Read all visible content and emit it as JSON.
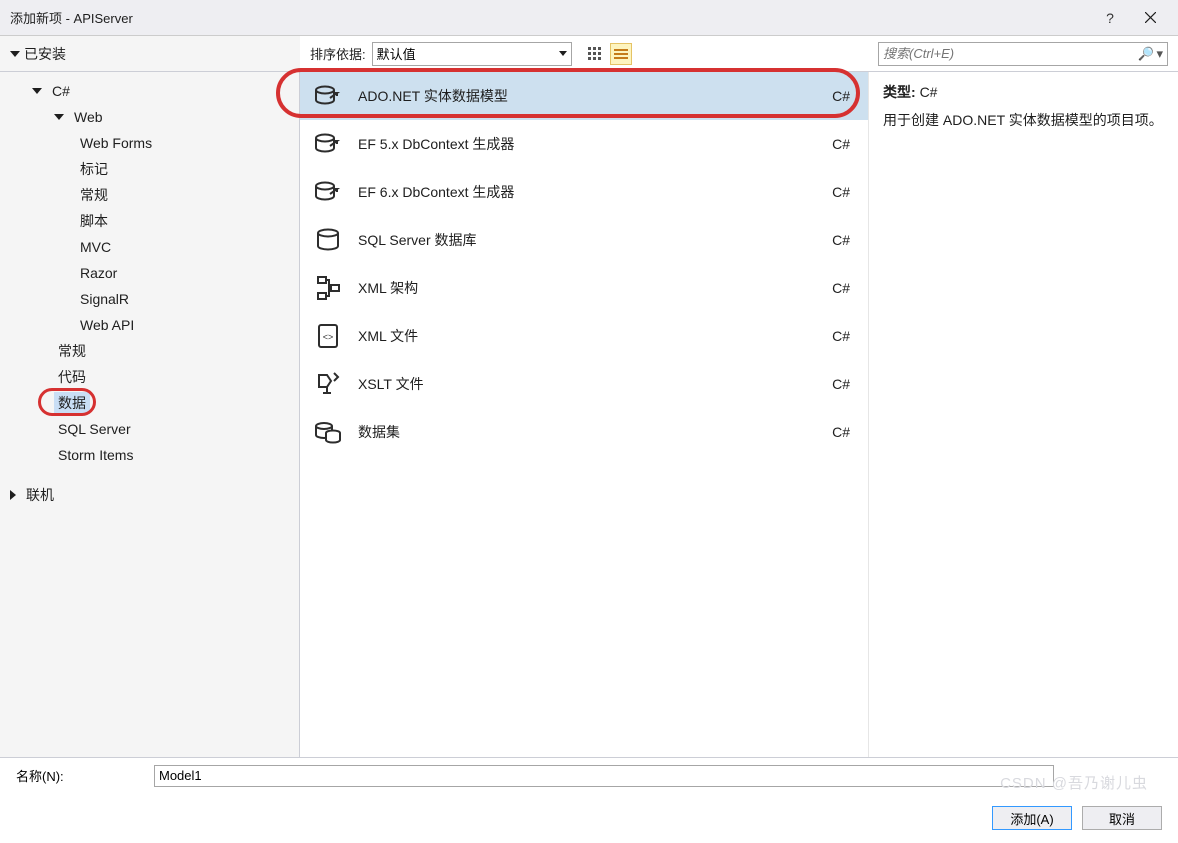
{
  "title": "添加新项 - APIServer",
  "sidebar": {
    "installed_label": "已安装",
    "online_label": "联机",
    "tree": [
      {
        "label": "C#",
        "indent": 1,
        "expanded": true
      },
      {
        "label": "Web",
        "indent": 2,
        "expanded": true
      },
      {
        "label": "Web Forms",
        "indent": 3,
        "leaf": true
      },
      {
        "label": "标记",
        "indent": 3,
        "leaf": true
      },
      {
        "label": "常规",
        "indent": 3,
        "leaf": true
      },
      {
        "label": "脚本",
        "indent": 3,
        "leaf": true
      },
      {
        "label": "MVC",
        "indent": 3,
        "leaf": true
      },
      {
        "label": "Razor",
        "indent": 3,
        "leaf": true
      },
      {
        "label": "SignalR",
        "indent": 3,
        "leaf": true
      },
      {
        "label": "Web API",
        "indent": 3,
        "leaf": true
      },
      {
        "label": "常规",
        "indent": 2,
        "leaf": true
      },
      {
        "label": "代码",
        "indent": 2,
        "leaf": true
      },
      {
        "label": "数据",
        "indent": 2,
        "leaf": true,
        "selected": true,
        "circled": true
      },
      {
        "label": "SQL Server",
        "indent": 2,
        "leaf": true
      },
      {
        "label": "Storm Items",
        "indent": 2,
        "leaf": true
      }
    ]
  },
  "toolbar": {
    "sort_label": "排序依据:",
    "sort_value": "默认值"
  },
  "search": {
    "placeholder": "搜索(Ctrl+E)"
  },
  "templates": [
    {
      "label": "ADO.NET 实体数据模型",
      "lang": "C#",
      "icon": "db-arrow",
      "selected": true
    },
    {
      "label": "EF 5.x DbContext 生成器",
      "lang": "C#",
      "icon": "db-arrow"
    },
    {
      "label": "EF 6.x DbContext 生成器",
      "lang": "C#",
      "icon": "db-arrow"
    },
    {
      "label": "SQL Server 数据库",
      "lang": "C#",
      "icon": "db"
    },
    {
      "label": "XML 架构",
      "lang": "C#",
      "icon": "xsd"
    },
    {
      "label": "XML 文件",
      "lang": "C#",
      "icon": "xml"
    },
    {
      "label": "XSLT 文件",
      "lang": "C#",
      "icon": "xslt"
    },
    {
      "label": "数据集",
      "lang": "C#",
      "icon": "dataset"
    }
  ],
  "info": {
    "type_label": "类型:",
    "type_value": "C#",
    "description": "用于创建 ADO.NET 实体数据模型的项目项。"
  },
  "name": {
    "label": "名称(N):",
    "value": "Model1"
  },
  "buttons": {
    "add": "添加(A)",
    "cancel": "取消"
  },
  "watermark": "CSDN @吾乃谢儿虫"
}
